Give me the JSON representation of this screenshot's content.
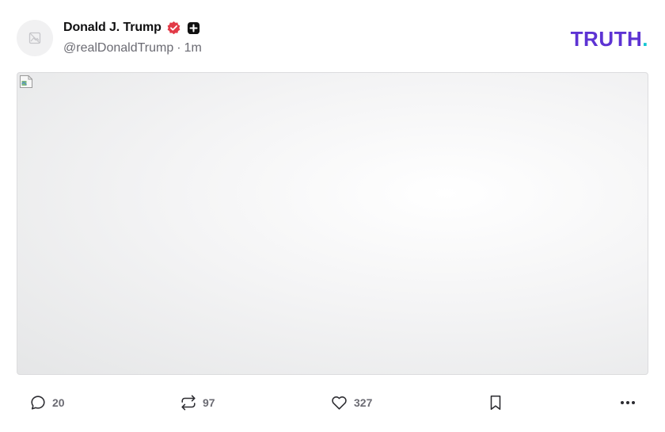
{
  "author": {
    "name": "Donald J. Trump",
    "handle": "@realDonaldTrump",
    "separator": "·",
    "time_ago": "1m",
    "verified_icon": "verified-badge-icon",
    "plus_icon": "plus-badge-icon"
  },
  "brand": {
    "logo_text": "TRUTH",
    "logo_dot": ".",
    "logo_color": "#5d33d3",
    "dot_color": "#14c6d2"
  },
  "media": {
    "icon": "broken-image-icon"
  },
  "actions": {
    "replies": "20",
    "retruths": "97",
    "likes": "327"
  },
  "colors": {
    "verified": "#e23a47",
    "muted_text": "#6b6b73"
  }
}
